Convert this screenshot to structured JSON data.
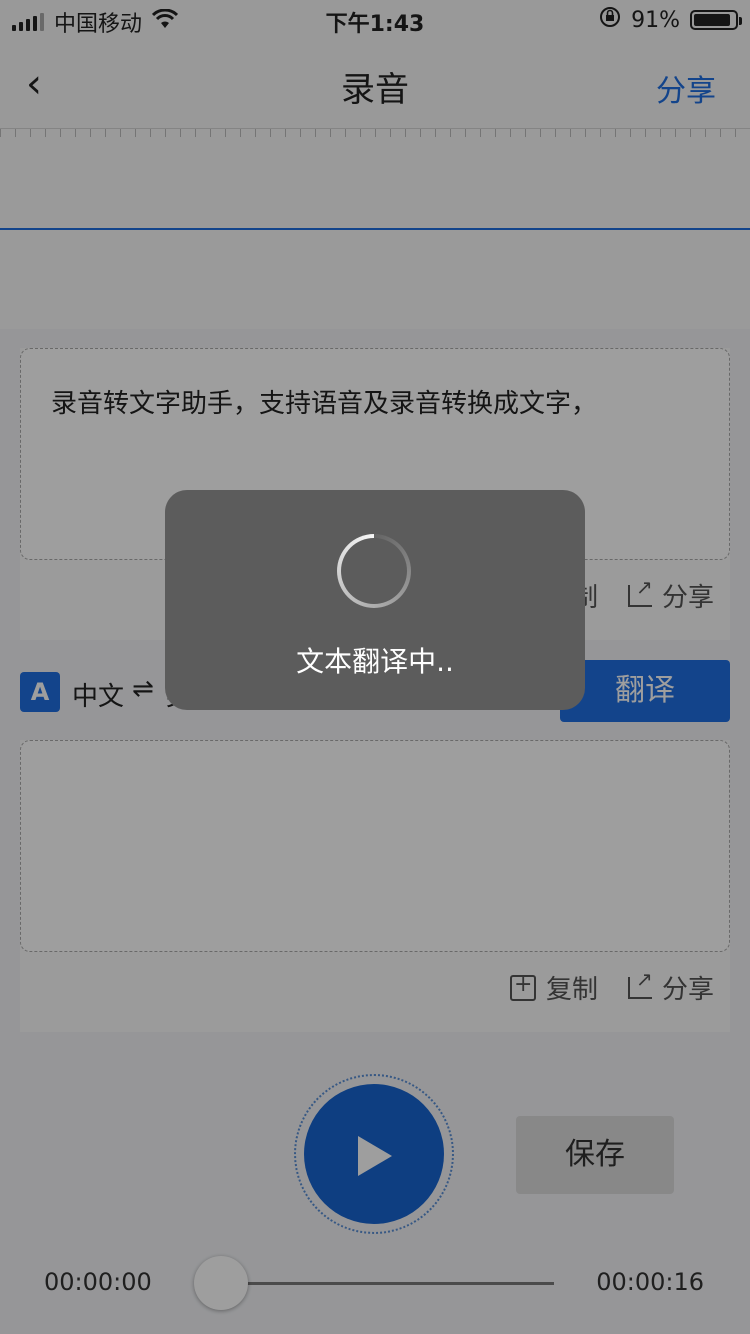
{
  "status_bar": {
    "carrier": "中国移动",
    "time": "下午1:43",
    "battery_percent": "91%",
    "battery_level": 0.91,
    "icons": [
      "signal-icon",
      "wifi-icon",
      "orientation-lock-icon",
      "battery-icon"
    ]
  },
  "nav": {
    "back_icon": "chevron-left-icon",
    "back_glyph": "‹",
    "title": "录音",
    "share_label": "分享"
  },
  "transcript": {
    "text": "录音转文字助手，支持语音及录音转换成文字，",
    "copy_label": "复制",
    "share_label": "分享"
  },
  "translation": {
    "from_lang": "中文",
    "swap_glyph": "⇌",
    "to_lang": "英文",
    "lang_icon_text": "A",
    "translate_label": "翻译",
    "text": "",
    "copy_label": "复制",
    "share_label": "分享"
  },
  "player": {
    "play_icon": "play-icon",
    "save_label": "保存",
    "time_current": "00:00:00",
    "time_total": "00:00:16",
    "progress": 0.0
  },
  "toast": {
    "message": "文本翻译中.."
  },
  "colors": {
    "accent": "#1f6fe0",
    "overlay": "rgba(0,0,0,0.38)",
    "toast_bg": "#5c5c5c"
  }
}
